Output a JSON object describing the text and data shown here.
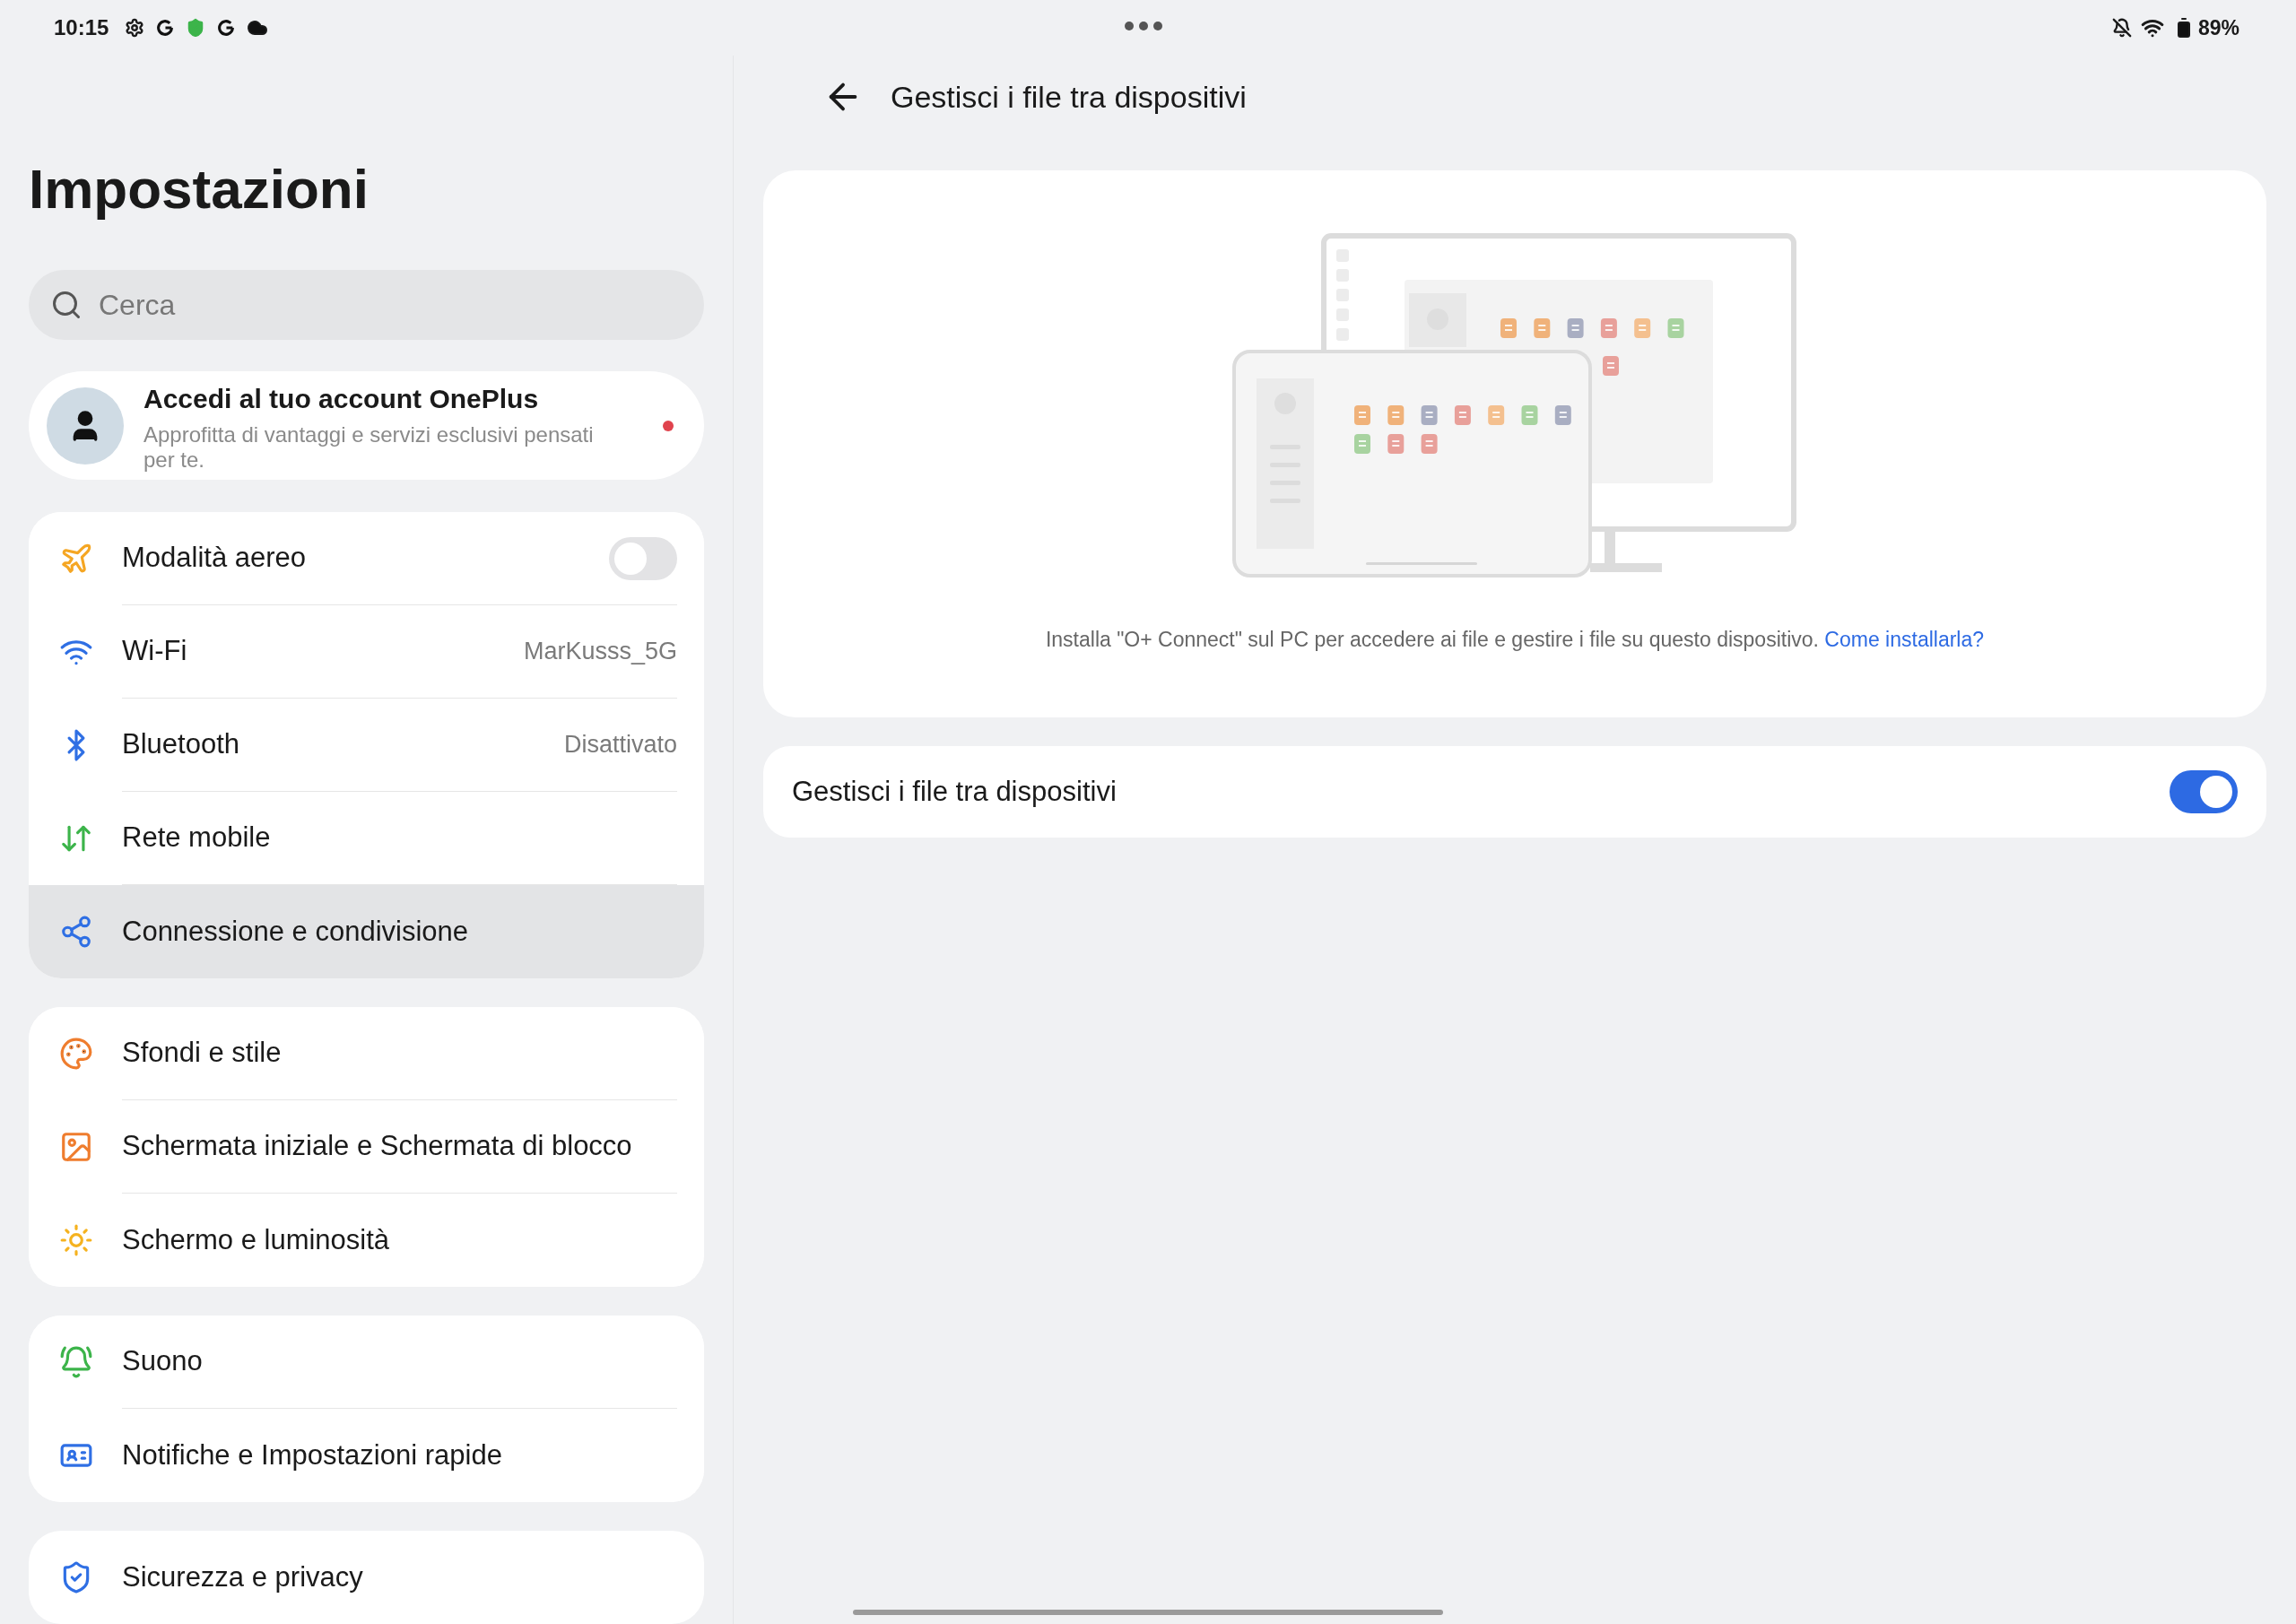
{
  "status_bar": {
    "time": "10:15",
    "battery": "89%"
  },
  "sidebar": {
    "title": "Impostazioni",
    "search": {
      "placeholder": "Cerca"
    },
    "account": {
      "title": "Accedi al tuo account OnePlus",
      "subtitle": "Approfitta di vantaggi e servizi esclusivi pensati per te.",
      "unread": true
    },
    "groups": [
      {
        "items": [
          {
            "kind": "toggle",
            "label": "Modalità aereo",
            "on": false,
            "selected": false
          },
          {
            "kind": "value",
            "label": "Wi-Fi",
            "value": "MarKusss_5G",
            "selected": false
          },
          {
            "kind": "value",
            "label": "Bluetooth",
            "value": "Disattivato",
            "selected": false
          },
          {
            "kind": "link",
            "label": "Rete mobile",
            "selected": false
          },
          {
            "kind": "link",
            "label": "Connessione e condivisione",
            "selected": true
          }
        ]
      },
      {
        "items": [
          {
            "kind": "link",
            "label": "Sfondi e stile",
            "selected": false
          },
          {
            "kind": "link",
            "label": "Schermata iniziale e Schermata di blocco",
            "selected": false
          },
          {
            "kind": "link",
            "label": "Schermo e luminosità",
            "selected": false
          }
        ]
      },
      {
        "items": [
          {
            "kind": "link",
            "label": "Suono",
            "selected": false
          },
          {
            "kind": "link",
            "label": "Notifiche e Impostazioni rapide",
            "selected": false
          }
        ]
      },
      {
        "items": [
          {
            "kind": "link",
            "label": "Sicurezza e privacy",
            "selected": false
          }
        ]
      }
    ]
  },
  "detail": {
    "title": "Gestisci i file tra dispositivi",
    "hint": "Installa \"O+ Connect\" sul PC per accedere ai file e gestire i file su questo dispositivo.",
    "hint_link": "Come installarla?",
    "setting": {
      "label": "Gestisci i file tra dispositivi",
      "on": true
    }
  }
}
